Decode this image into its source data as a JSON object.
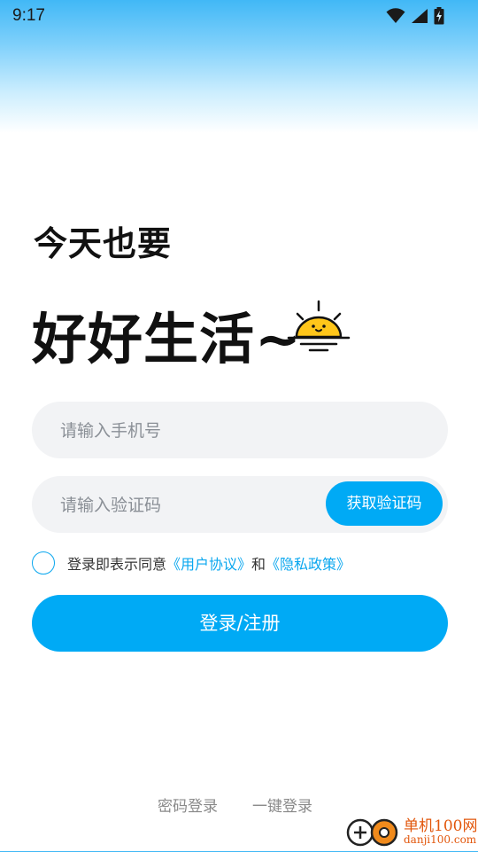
{
  "status_bar": {
    "time": "9:17",
    "icons": [
      "wifi-icon",
      "signal-icon",
      "battery-charging-icon"
    ]
  },
  "headline": {
    "line1": "今天也要",
    "line2": "好好生活~"
  },
  "illustration": "sun-icon",
  "form": {
    "phone_placeholder": "请输入手机号",
    "code_placeholder": "请输入验证码",
    "get_code_label": "获取验证码"
  },
  "agreement": {
    "prefix": "登录即表示同意",
    "user_agreement": "《用户协议》",
    "connector": "和",
    "privacy_policy": "《隐私政策》",
    "checked": false
  },
  "login_button_label": "登录/注册",
  "alt_login": {
    "password_login": "密码登录",
    "onekey_login": "一键登录"
  },
  "watermark": {
    "name": "单机100网",
    "domain": "danji100.com"
  },
  "colors": {
    "accent": "#00aaf5",
    "link": "#0aa7ef",
    "field_bg": "#f2f3f5",
    "watermark": "#e2570c"
  }
}
